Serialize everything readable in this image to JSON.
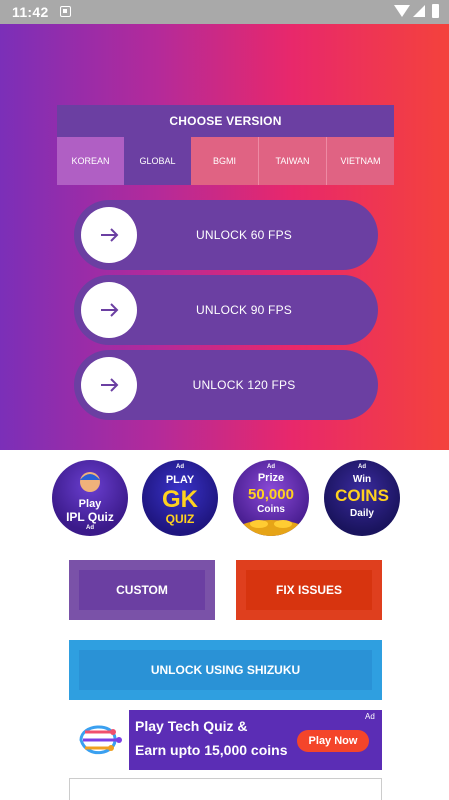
{
  "status_bar": {
    "time": "11:42"
  },
  "version": {
    "title": "CHOOSE VERSION",
    "tabs": [
      "KOREAN",
      "GLOBAL",
      "BGMI",
      "TAIWAN",
      "VIETNAM"
    ],
    "selected": "KOREAN"
  },
  "fps_buttons": [
    {
      "label": "UNLOCK 60 FPS",
      "icon": "arrow-right-icon"
    },
    {
      "label": "UNLOCK 90 FPS",
      "icon": "arrow-right-icon"
    },
    {
      "label": "UNLOCK 120 FPS",
      "icon": "arrow-right-icon"
    }
  ],
  "ads": [
    {
      "line1": "Play",
      "line2": "IPL Quiz",
      "ad": "Ad"
    },
    {
      "line1": "PLAY",
      "line2": "GK",
      "line3": "QUIZ",
      "ad": "Ad"
    },
    {
      "line1": "Prize",
      "line2": "50,000",
      "line3": "Coins",
      "ad": "Ad"
    },
    {
      "line1": "Win",
      "line2": "COINS",
      "line3": "Daily",
      "ad": "Ad"
    }
  ],
  "buttons": {
    "custom": "CUSTOM",
    "fix_issues": "FIX ISSUES",
    "shizuku": "UNLOCK USING SHIZUKU"
  },
  "banner": {
    "line1": "Play Tech Quiz &",
    "line2": "Earn upto 15,000 coins",
    "cta": "Play Now",
    "ad": "Ad"
  },
  "colors": {
    "primary_purple": "#6b3fa2",
    "fix_red": "#d7340f",
    "shizuku_blue": "#2a92d6",
    "gradient_start": "#7b2fb8",
    "gradient_end": "#f4423c"
  }
}
